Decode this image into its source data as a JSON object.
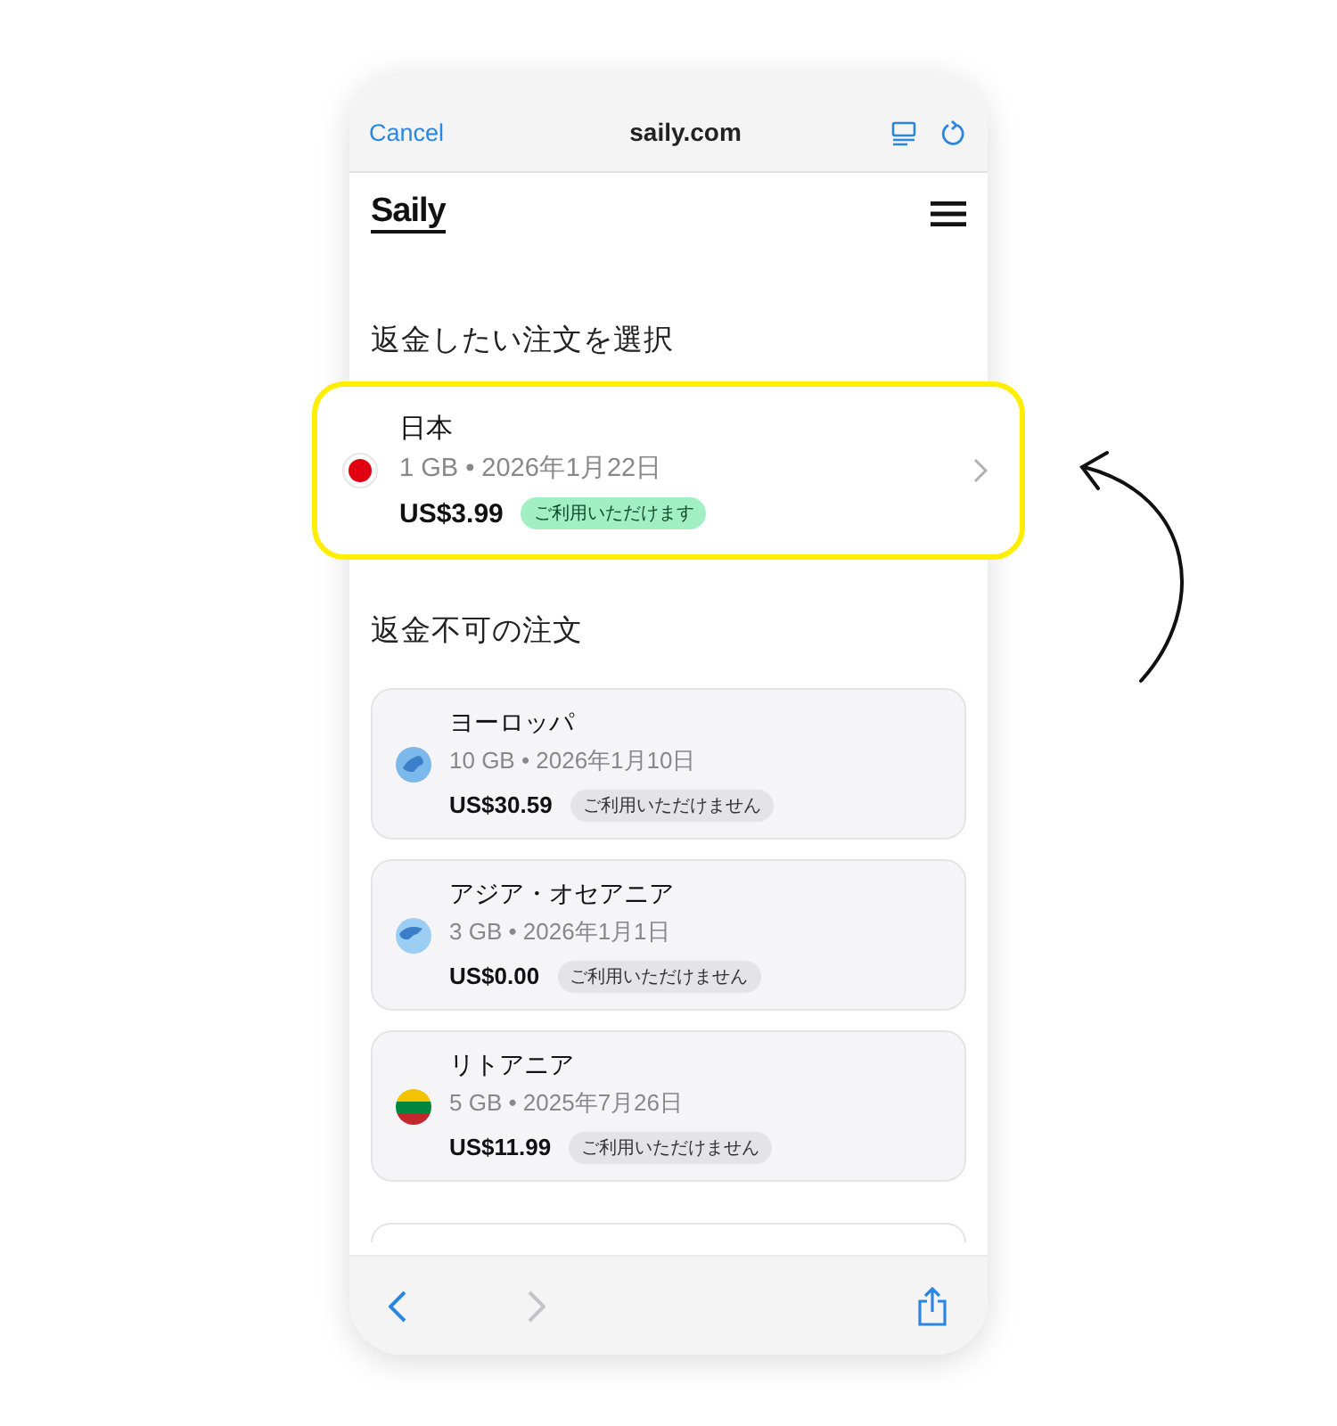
{
  "browser_bar": {
    "cancel": "Cancel",
    "url": "saily.com"
  },
  "site_header": {
    "logo": "Saily"
  },
  "refundable": {
    "heading": "返金したい注文を選択",
    "orders": [
      {
        "name": "日本",
        "details": "1 GB • 2026年1月22日",
        "price": "US$3.99",
        "status": "ご利用いただけます",
        "available": true,
        "highlighted": true
      }
    ]
  },
  "non_refundable": {
    "heading": "返金不可の注文",
    "orders": [
      {
        "name": "ヨーロッパ",
        "details": "10 GB • 2026年1月10日",
        "price": "US$30.59",
        "status": "ご利用いただけません",
        "available": false,
        "highlighted": false
      },
      {
        "name": "アジア・オセアニア",
        "details": "3 GB • 2026年1月1日",
        "price": "US$0.00",
        "status": "ご利用いただけません",
        "available": false,
        "highlighted": false
      },
      {
        "name": "リトアニア",
        "details": "5 GB • 2025年7月26日",
        "price": "US$11.99",
        "status": "ご利用いただけません",
        "available": false,
        "highlighted": false
      }
    ]
  },
  "toolbar": {
    "buttons": [
      {
        "kind": "back",
        "disabled": false
      },
      {
        "kind": "forward",
        "disabled": true
      },
      {
        "kind": "share",
        "disabled": false
      }
    ]
  }
}
